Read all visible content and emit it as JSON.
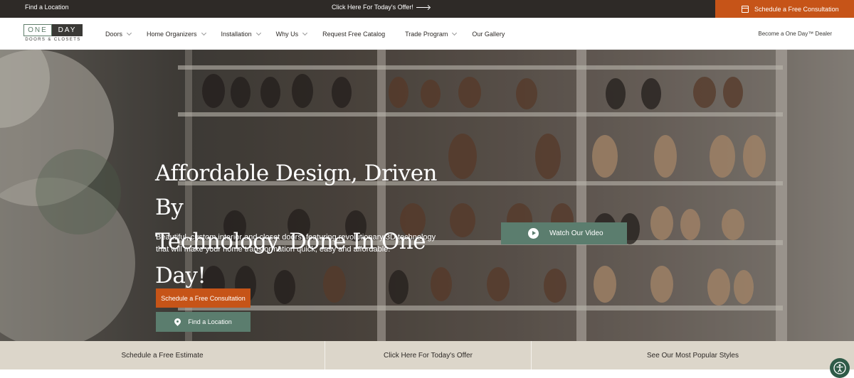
{
  "topbar": {
    "find_location": "Find a Location",
    "offer": "Click Here For Today's Offer!",
    "cta": "Schedule a Free Consultation"
  },
  "logo": {
    "word1": "ONE",
    "word2": "DAY",
    "sub": "DOORS & CLOSETS"
  },
  "nav": {
    "items": [
      {
        "label": "Doors",
        "dropdown": true
      },
      {
        "label": "Home Organizers",
        "dropdown": true
      },
      {
        "label": "Installation",
        "dropdown": true
      },
      {
        "label": "Why Us",
        "dropdown": true
      },
      {
        "label": "Request Free Catalog",
        "dropdown": false
      },
      {
        "label": "Trade Program",
        "dropdown": true
      },
      {
        "label": "Our Gallery",
        "dropdown": false
      }
    ],
    "dealer": "Become a One Day™ Dealer"
  },
  "hero": {
    "title_line1": "Affordable Design, Driven By",
    "title_line2": "Technology, Done In One Day!",
    "subtitle": "Beautiful, custom interior and closet doors, featuring revolutionary 3D technology that will make your home transformation quick, easy and affordable.",
    "consult_button": "Schedule a Free Consultation",
    "find_button": "Find a Location",
    "video_button": "Watch Our Video"
  },
  "strip": {
    "items": [
      "Schedule a Free Estimate",
      "Click Here For Today's Offer",
      "See Our Most Popular Styles"
    ]
  },
  "colors": {
    "orange": "#c65418",
    "green": "#5b7d6e",
    "dark": "#2e2a27",
    "strip": "#dcd6ca"
  }
}
